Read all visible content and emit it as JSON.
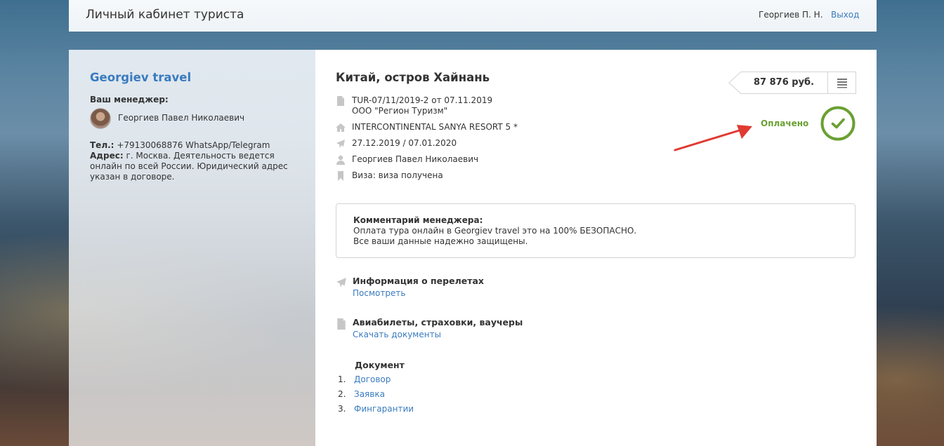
{
  "header": {
    "title": "Личный кабинет туриста",
    "user": "Георгиев П. Н.",
    "logout": "Выход"
  },
  "sidebar": {
    "brand": "Georgiev travel",
    "manager_label": "Ваш менеджер:",
    "manager_name": "Георгиев Павел Николаевич",
    "phone_label": "Тел.:",
    "phone": "+79130068876 WhatsApp/Telegram",
    "address_label": "Адрес:",
    "address": "г. Москва. Деятельность ведется онлайн по всей России. Юридический адрес указан в договоре."
  },
  "tour": {
    "title": "Китай, остров Хайнань",
    "order_number": "TUR-07/11/2019-2 от 07.11.2019",
    "operator": "ООО \"Регион Туризм\"",
    "hotel": "INTERCONTINENTAL SANYA RESORT 5 *",
    "dates": "27.12.2019 / 07.01.2020",
    "tourist": "Георгиев Павел Николаевич",
    "visa": "Виза: виза получена",
    "price": "87 876 руб.",
    "status": "Оплачено"
  },
  "comment": {
    "heading": "Комментарий менеджера:",
    "line1": "Оплата тура онлайн в Georgiev travel это на 100% БЕЗОПАСНО.",
    "line2": "Все ваши данные надежно защищены."
  },
  "sections": {
    "flights": {
      "heading": "Информация о перелетах",
      "link": "Посмотреть"
    },
    "documents": {
      "heading": "Авиабилеты, страховки, ваучеры",
      "link": "Скачать документы"
    }
  },
  "doc_list": {
    "title": "Документ",
    "items": [
      {
        "num": "1.",
        "label": "Договор"
      },
      {
        "num": "2.",
        "label": "Заявка"
      },
      {
        "num": "3.",
        "label": "Фингарантии"
      }
    ]
  },
  "colors": {
    "link": "#3a7bbf",
    "paid": "#6aa033",
    "arrow": "#e03a31"
  },
  "icons": {
    "document": "document-icon",
    "hotel": "home-icon",
    "flight": "plane-icon",
    "tourist": "user-icon",
    "visa": "bookmark-icon",
    "menu": "list-icon",
    "paid": "check-circle-icon"
  }
}
